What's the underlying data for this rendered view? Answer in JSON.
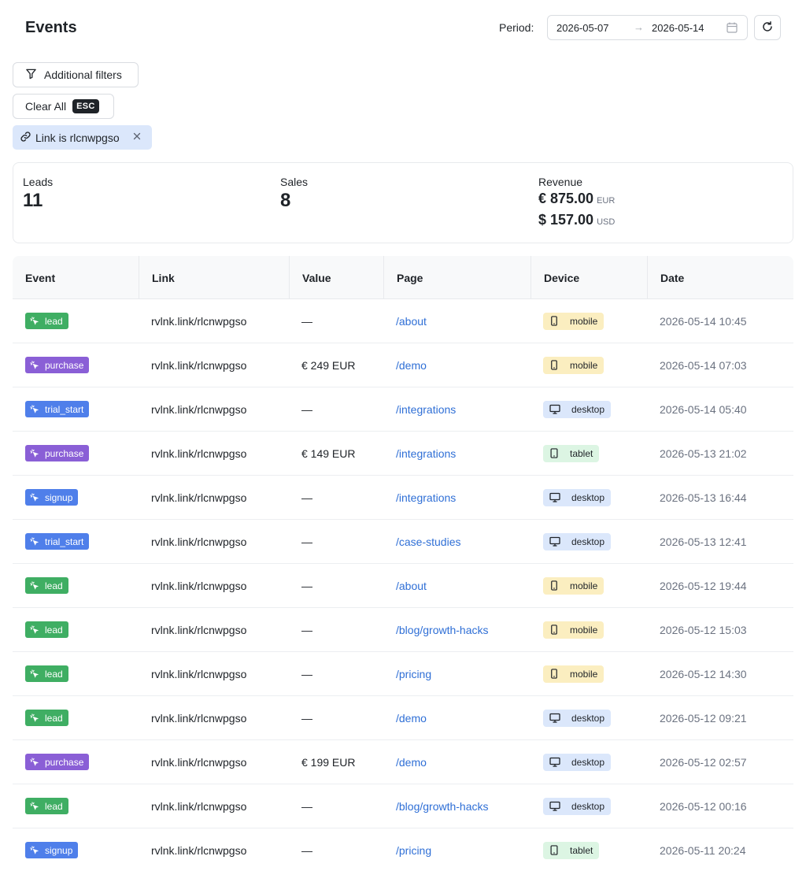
{
  "header": {
    "title": "Events",
    "period_label": "Period:",
    "start_date": "2026-05-07",
    "arrow": "→",
    "end_date": "2026-05-14"
  },
  "filters": {
    "additional_label": "Additional filters",
    "clear_label": "Clear All",
    "clear_shortcut": "ESC",
    "active_chip": "Link is rlcnwpgso"
  },
  "stats": {
    "leads_label": "Leads",
    "leads_value": "11",
    "sales_label": "Sales",
    "sales_value": "8",
    "revenue_label": "Revenue",
    "revenue": [
      {
        "amount": "€ 875.00",
        "currency": "EUR"
      },
      {
        "amount": "$ 157.00",
        "currency": "USD"
      }
    ]
  },
  "table": {
    "columns": [
      "Event",
      "Link",
      "Value",
      "Page",
      "Device",
      "Date"
    ],
    "rows": [
      {
        "event": "lead",
        "link": "rvlnk.link/rlcnwpgso",
        "value": "—",
        "page": "/about",
        "device": "mobile",
        "date": "2026-05-14 10:45"
      },
      {
        "event": "purchase",
        "link": "rvlnk.link/rlcnwpgso",
        "value": "€ 249 EUR",
        "page": "/demo",
        "device": "mobile",
        "date": "2026-05-14 07:03"
      },
      {
        "event": "trial_start",
        "link": "rvlnk.link/rlcnwpgso",
        "value": "—",
        "page": "/integrations",
        "device": "desktop",
        "date": "2026-05-14 05:40"
      },
      {
        "event": "purchase",
        "link": "rvlnk.link/rlcnwpgso",
        "value": "€ 149 EUR",
        "page": "/integrations",
        "device": "tablet",
        "date": "2026-05-13 21:02"
      },
      {
        "event": "signup",
        "link": "rvlnk.link/rlcnwpgso",
        "value": "—",
        "page": "/integrations",
        "device": "desktop",
        "date": "2026-05-13 16:44"
      },
      {
        "event": "trial_start",
        "link": "rvlnk.link/rlcnwpgso",
        "value": "—",
        "page": "/case-studies",
        "device": "desktop",
        "date": "2026-05-13 12:41"
      },
      {
        "event": "lead",
        "link": "rvlnk.link/rlcnwpgso",
        "value": "—",
        "page": "/about",
        "device": "mobile",
        "date": "2026-05-12 19:44"
      },
      {
        "event": "lead",
        "link": "rvlnk.link/rlcnwpgso",
        "value": "—",
        "page": "/blog/growth-hacks",
        "device": "mobile",
        "date": "2026-05-12 15:03"
      },
      {
        "event": "lead",
        "link": "rvlnk.link/rlcnwpgso",
        "value": "—",
        "page": "/pricing",
        "device": "mobile",
        "date": "2026-05-12 14:30"
      },
      {
        "event": "lead",
        "link": "rvlnk.link/rlcnwpgso",
        "value": "—",
        "page": "/demo",
        "device": "desktop",
        "date": "2026-05-12 09:21"
      },
      {
        "event": "purchase",
        "link": "rvlnk.link/rlcnwpgso",
        "value": "€ 199 EUR",
        "page": "/demo",
        "device": "desktop",
        "date": "2026-05-12 02:57"
      },
      {
        "event": "lead",
        "link": "rvlnk.link/rlcnwpgso",
        "value": "—",
        "page": "/blog/growth-hacks",
        "device": "desktop",
        "date": "2026-05-12 00:16"
      },
      {
        "event": "signup",
        "link": "rvlnk.link/rlcnwpgso",
        "value": "—",
        "page": "/pricing",
        "device": "tablet",
        "date": "2026-05-11 20:24"
      }
    ]
  },
  "colors": {
    "lead": "#3fae63",
    "purchase": "#8a5fd6",
    "trial_start": "#4f7fea",
    "signup": "#4f7fea",
    "mobile": "#fbeec0",
    "desktop": "#dbe7fb",
    "tablet": "#dcf5e3",
    "link": "#2f6fd6"
  },
  "icons": {
    "event": "cursor-click-icon",
    "mobile": "smartphone-icon",
    "desktop": "monitor-icon",
    "tablet": "tablet-icon",
    "filter": "funnel-icon",
    "chip": "link-icon",
    "remove": "close-icon",
    "calendar": "calendar-icon",
    "refresh": "refresh-icon"
  }
}
